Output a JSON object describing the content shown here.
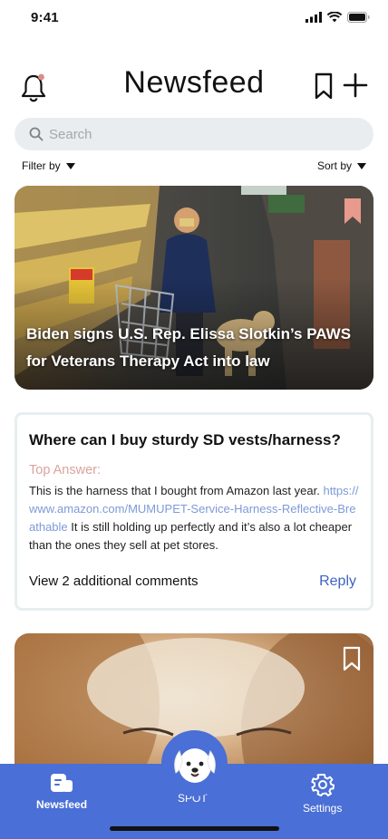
{
  "status": {
    "time": "9:41"
  },
  "header": {
    "title": "Newsfeed"
  },
  "search": {
    "placeholder": "Search"
  },
  "filters": {
    "filter_label": "Filter by",
    "sort_label": "Sort by"
  },
  "news_card": {
    "title": "Biden signs U.S. Rep. Elissa Slotkin’s PAWS for Veterans Therapy Act into law"
  },
  "question_card": {
    "question": "Where can I buy sturdy SD vests/harness?",
    "top_answer_label": "Top Answer:",
    "answer_text_1": "This is the harness that I bought from Amazon last year.",
    "answer_link": "https://www.amazon.com/MUMUPET-Service-Harness-Reflective-Breathable",
    "answer_text_2": "It is still holding up perfectly and it’s also a lot cheaper than the ones they sell at pet stores.",
    "comments_label": "View 2 additional comments",
    "reply_label": "Reply"
  },
  "nav": {
    "newsfeed_label": "Newsfeed",
    "spot_label": "SPOT",
    "settings_label": "Settings"
  },
  "colors": {
    "accent": "#4a6fd6",
    "answer_label": "#d9a39d",
    "link": "#7d9ad8",
    "search_bg": "#e9edf0"
  }
}
